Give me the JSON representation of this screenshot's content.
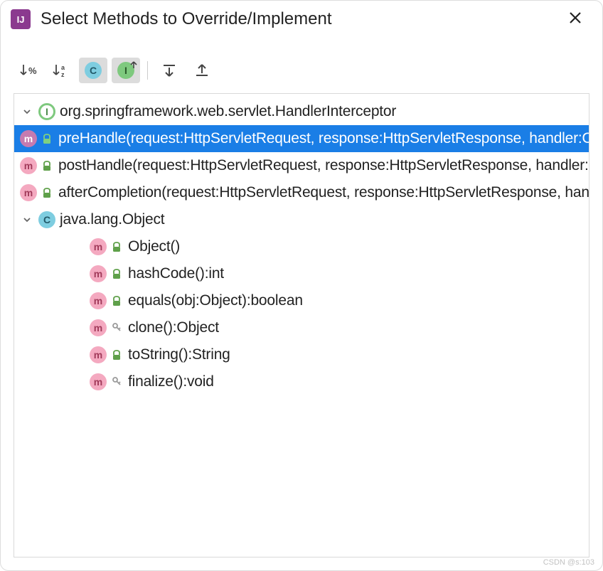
{
  "dialog": {
    "title": "Select Methods to Override/Implement",
    "app_icon_label": "IJ"
  },
  "toolbar": {
    "sort_percent": {
      "name": "sort-percent"
    },
    "sort_alpha": {
      "name": "sort-alpha"
    },
    "show_classes": {
      "name": "show-classes",
      "letter": "C"
    },
    "show_interfaces": {
      "name": "show-interfaces",
      "letter": "I"
    },
    "expand_all": {
      "name": "expand-all"
    },
    "collapse_all": {
      "name": "collapse-all"
    }
  },
  "tree": [
    {
      "kind": "interface",
      "expanded": true,
      "label": "org.springframework.web.servlet.HandlerInterceptor",
      "children": [
        {
          "kind": "method",
          "visibility": "public",
          "selected": true,
          "label": "preHandle(request:HttpServletRequest, response:HttpServletResponse, handler:Object):boolean"
        },
        {
          "kind": "method",
          "visibility": "public",
          "selected": false,
          "label": "postHandle(request:HttpServletRequest, response:HttpServletResponse, handler:Object, modelAndView:ModelAndView):void"
        },
        {
          "kind": "method",
          "visibility": "public",
          "selected": false,
          "label": "afterCompletion(request:HttpServletRequest, response:HttpServletResponse, handler:Object, ex:Exception):void"
        }
      ]
    },
    {
      "kind": "class",
      "expanded": true,
      "label": "java.lang.Object",
      "children": [
        {
          "kind": "method",
          "visibility": "public",
          "selected": false,
          "label": "Object()"
        },
        {
          "kind": "method",
          "visibility": "public",
          "selected": false,
          "label": "hashCode():int"
        },
        {
          "kind": "method",
          "visibility": "public",
          "selected": false,
          "label": "equals(obj:Object):boolean"
        },
        {
          "kind": "method",
          "visibility": "protected",
          "selected": false,
          "label": "clone():Object"
        },
        {
          "kind": "method",
          "visibility": "public",
          "selected": false,
          "label": "toString():String"
        },
        {
          "kind": "method",
          "visibility": "protected",
          "selected": false,
          "label": "finalize():void"
        }
      ]
    }
  ],
  "colors": {
    "selection": "#1a7ee6",
    "interface_badge": "#7ec97e",
    "class_badge": "#7ecde0",
    "method_badge": "#f4a9c0",
    "public_green": "#5fa04a",
    "protected_gray": "#9a9a9a"
  },
  "watermark": "CSDN @s:103"
}
